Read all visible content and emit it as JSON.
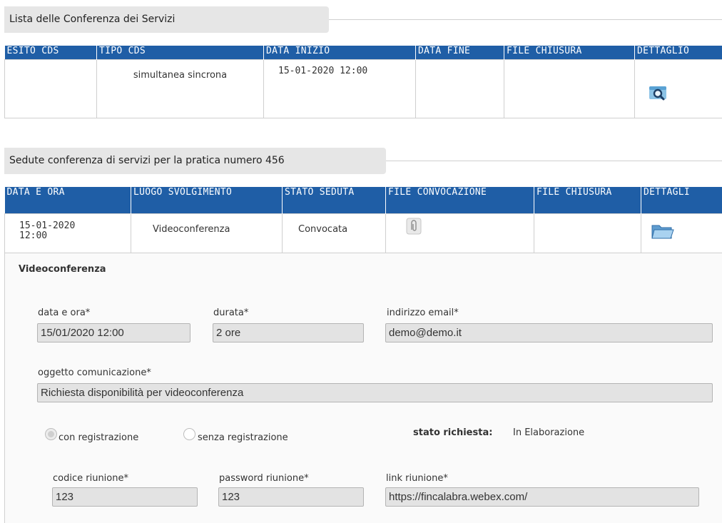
{
  "section1": {
    "title": "Lista delle Conferenza dei Servizi",
    "columns": [
      "ESITO CDS",
      "TIPO CDS",
      "DATA INIZIO",
      "DATA FINE",
      "FILE CHIUSURA",
      "DETTAGLIO"
    ],
    "row": {
      "esito": "",
      "tipo": "simultanea sincrona",
      "data_inizio": "15-01-2020 12:00",
      "data_fine": "",
      "file_chiusura": "",
      "dettaglio_icon": "magnifier-icon"
    }
  },
  "section2": {
    "title": "Sedute conferenza di servizi per la pratica numero 456",
    "columns": [
      "DATA E ORA",
      "LUOGO SVOLGIMENTO",
      "STATO SEDUTA",
      "FILE CONVOCAZIONE",
      "FILE CHIUSURA",
      "DETTAGLI"
    ],
    "row": {
      "data_ora": "15-01-2020 12:00",
      "luogo": "Videoconferenza",
      "stato": "Convocata",
      "file_convocazione_icon": "paperclip-icon",
      "file_chiusura": "",
      "dettagli_icon": "folder-icon"
    }
  },
  "detail": {
    "heading": "Videoconferenza",
    "data_ora_label": "data e ora*",
    "data_ora_value": "15/01/2020 12:00",
    "durata_label": "durata*",
    "durata_value": "2 ore",
    "email_label": "indirizzo email*",
    "email_value": "demo@demo.it",
    "oggetto_label": "oggetto comunicazione*",
    "oggetto_value": "Richiesta disponibilità per videoconferenza",
    "radio_con": "con registrazione",
    "radio_senza": "senza registrazione",
    "radio_selected": "con registrazione",
    "stato_label": "stato richiesta:",
    "stato_value": "In Elaborazione",
    "codice_label": "codice riunione*",
    "codice_value": "123",
    "password_label": "password riunione*",
    "password_value": "123",
    "link_label": "link riunione*",
    "link_value": "https://fincalabra.webex.com/"
  },
  "colors": {
    "header_blue": "#1f5ea6",
    "legend_bg": "#e6e6e6",
    "field_bg": "#e3e3e3"
  }
}
